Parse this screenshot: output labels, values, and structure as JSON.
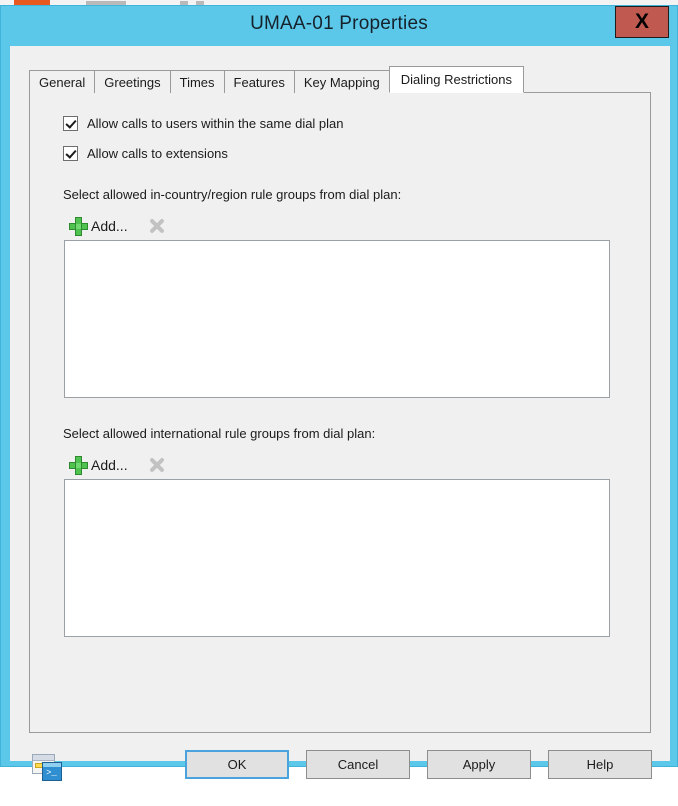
{
  "background_window": {
    "visible": true,
    "accent_color": "#e8591f"
  },
  "window": {
    "title": "UMAA-01 Properties",
    "titlebar_color": "#5bc8ea",
    "close_button_label": "X",
    "close_button_color": "#c05a51"
  },
  "tabs": [
    {
      "label": "General",
      "active": false
    },
    {
      "label": "Greetings",
      "active": false
    },
    {
      "label": "Times",
      "active": false
    },
    {
      "label": "Features",
      "active": false
    },
    {
      "label": "Key Mapping",
      "active": false
    },
    {
      "label": "Dialing Restrictions",
      "active": true
    }
  ],
  "checkboxes": [
    {
      "label": "Allow calls to users within the same dial plan",
      "checked": true
    },
    {
      "label": "Allow calls to extensions",
      "checked": true
    }
  ],
  "sections": {
    "in_country": {
      "label": "Select allowed in-country/region rule groups from dial plan:",
      "add_label": "Add...",
      "add_icon": "green-plus-icon",
      "delete_icon": "gray-x-icon",
      "delete_enabled": false,
      "items": []
    },
    "international": {
      "label": "Select allowed international rule groups from dial plan:",
      "add_label": "Add...",
      "add_icon": "green-plus-icon",
      "delete_icon": "gray-x-icon",
      "delete_enabled": false,
      "items": []
    }
  },
  "footer": {
    "log_icon": "powershell-command-log-icon",
    "buttons": [
      {
        "label": "OK",
        "default": true
      },
      {
        "label": "Cancel",
        "default": false
      },
      {
        "label": "Apply",
        "default": false
      },
      {
        "label": "Help",
        "default": false
      }
    ]
  },
  "colors": {
    "accent": "#5bc8ea",
    "close": "#c05a51",
    "focus_border": "#4aa3dd",
    "add_icon_green": "#4fc24f",
    "dialog_face": "#f0f0f0"
  }
}
